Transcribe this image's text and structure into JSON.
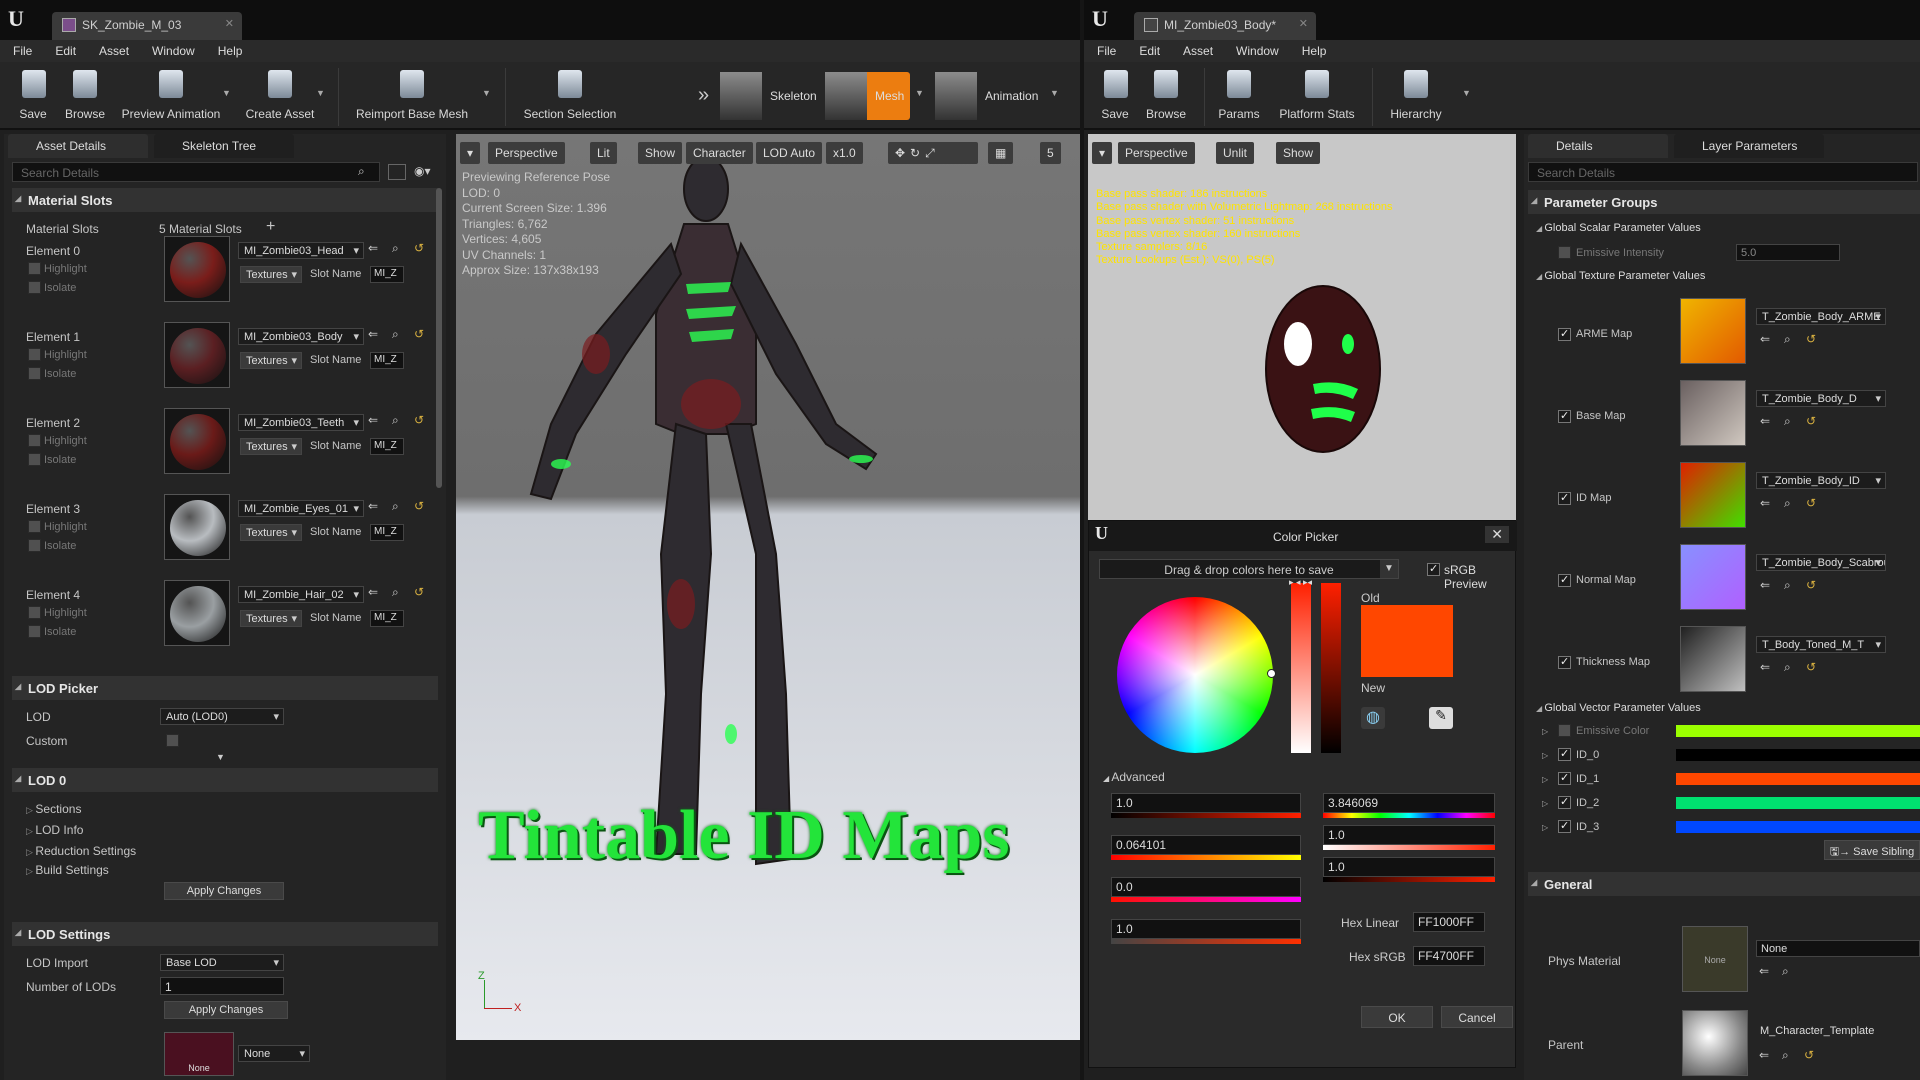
{
  "left_window": {
    "tab_title": "SK_Zombie_M_03",
    "menu": [
      "File",
      "Edit",
      "Asset",
      "Window",
      "Help"
    ],
    "toolbar": [
      {
        "label": "Save",
        "icon": "save-icon"
      },
      {
        "label": "Browse",
        "icon": "browse-icon"
      },
      {
        "label": "Preview Animation",
        "icon": "preview-animation-icon"
      },
      {
        "label": "Create Asset",
        "icon": "create-asset-icon"
      },
      {
        "label": "Reimport Base Mesh",
        "icon": "reimport-icon"
      },
      {
        "label": "Section Selection",
        "icon": "section-selection-icon"
      }
    ],
    "modes": [
      {
        "label": "Skeleton"
      },
      {
        "label": "Mesh",
        "active": true
      },
      {
        "label": "Animation"
      }
    ],
    "panel_tabs": [
      "Asset Details",
      "Skeleton Tree"
    ],
    "search_placeholder": "Search Details",
    "material_slots": {
      "category": "Material Slots",
      "label": "Material Slots",
      "count_text": "5 Material Slots",
      "add_icon": "+",
      "highlight_label": "Highlight",
      "isolate_label": "Isolate",
      "textures_label": "Textures",
      "slot_name_label": "Slot Name",
      "elements": [
        {
          "label": "Element 0",
          "material": "MI_Zombie03_Head",
          "slot": "MI_Z",
          "thumb": "#7a1d1a"
        },
        {
          "label": "Element 1",
          "material": "MI_Zombie03_Body",
          "slot": "MI_Z",
          "thumb": "#5b1f22"
        },
        {
          "label": "Element 2",
          "material": "MI_Zombie03_Teeth",
          "slot": "MI_Z",
          "thumb": "#6a1a18"
        },
        {
          "label": "Element 3",
          "material": "MI_Zombie_Eyes_01",
          "slot": "MI_Z",
          "thumb": "#b8bcc0"
        },
        {
          "label": "Element 4",
          "material": "MI_Zombie_Hair_02",
          "slot": "MI_Z",
          "thumb": "#9a9fa2"
        }
      ]
    },
    "lod_picker": {
      "category": "LOD Picker",
      "lod_label": "LOD",
      "lod_value": "Auto (LOD0)",
      "custom_label": "Custom"
    },
    "lod0": {
      "category": "LOD 0",
      "items": [
        "Sections",
        "LOD Info",
        "Reduction Settings",
        "Build Settings"
      ],
      "apply": "Apply Changes"
    },
    "lod_settings": {
      "category": "LOD Settings",
      "import_label": "LOD Import",
      "import_value": "Base LOD",
      "num_label": "Number of LODs",
      "num_value": "1",
      "apply": "Apply Changes",
      "thumb_label": "None",
      "thumb_dropdown": "None"
    },
    "viewport": {
      "buttons": [
        "Perspective",
        "Lit",
        "Show",
        "Character",
        "LOD Auto",
        "x1.0"
      ],
      "grid_value": "5",
      "info": [
        "Previewing Reference Pose",
        "LOD: 0",
        "Current Screen Size: 1.396",
        "Triangles: 6,762",
        "Vertices: 4,605",
        "UV Channels: 1",
        "Approx Size: 137x38x193"
      ],
      "overlay_text": "Tintable ID Maps",
      "axis_z": "Z",
      "axis_x": "X"
    }
  },
  "right_window": {
    "tab_title": "MI_Zombie03_Body*",
    "menu": [
      "File",
      "Edit",
      "Asset",
      "Window",
      "Help"
    ],
    "toolbar": [
      {
        "label": "Save",
        "icon": "save-icon"
      },
      {
        "label": "Browse",
        "icon": "browse-icon"
      },
      {
        "label": "Params",
        "icon": "params-icon"
      },
      {
        "label": "Platform Stats",
        "icon": "platform-stats-icon"
      },
      {
        "label": "Hierarchy",
        "icon": "hierarchy-icon"
      }
    ],
    "viewport": {
      "buttons": [
        "Perspective",
        "Unlit",
        "Show"
      ],
      "shader_stats": [
        "Base pass shader: 186 instructions",
        "Base pass shader with Volumetric Lightmap: 268 instructions",
        "Base pass vertex shader: 51 instructions",
        "Base pass vertex shader: 160 instructions",
        "Texture samplers: 8/16",
        "Texture Lookups (Est.): VS(0), PS(5)"
      ]
    },
    "details": {
      "tabs": [
        "Details",
        "Layer Parameters"
      ],
      "search_placeholder": "Search Details",
      "param_groups": "Parameter Groups",
      "scalar_group": "Global Scalar Parameter Values",
      "emissive_intensity": {
        "label": "Emissive Intensity",
        "value": "5.0"
      },
      "texture_group": "Global Texture Parameter Values",
      "textures": [
        {
          "label": "ARME Map",
          "asset": "T_Zombie_Body_ARME"
        },
        {
          "label": "Base Map",
          "asset": "T_Zombie_Body_D"
        },
        {
          "label": "ID Map",
          "asset": "T_Zombie_Body_ID"
        },
        {
          "label": "Normal Map",
          "asset": "T_Zombie_Body_Scabrous"
        },
        {
          "label": "Thickness Map",
          "asset": "T_Body_Toned_M_T"
        }
      ],
      "vector_group": "Global Vector Parameter Values",
      "vectors": [
        {
          "label": "Emissive Color",
          "color": "#9bff00",
          "enabled": false
        },
        {
          "label": "ID_0",
          "color": "#000000",
          "enabled": true
        },
        {
          "label": "ID_1",
          "color": "#ff4700",
          "enabled": true
        },
        {
          "label": "ID_2",
          "color": "#00e070",
          "enabled": true
        },
        {
          "label": "ID_3",
          "color": "#0048ff",
          "enabled": true
        }
      ],
      "save_sibling": "Save Sibling",
      "general": "General",
      "phys_material": {
        "label": "Phys Material",
        "value": "None",
        "thumb": "None"
      },
      "parent": {
        "label": "Parent",
        "value": "M_Character_Template"
      }
    },
    "color_picker": {
      "title": "Color Picker",
      "drop_text": "Drag & drop colors here to save",
      "srgb_preview": "sRGB Preview",
      "old_label": "Old",
      "new_label": "New",
      "advanced": "Advanced",
      "R": "1.0",
      "G": "0.064101",
      "B": "0.0",
      "A": "1.0",
      "H": "3.846069",
      "S": "1.0",
      "V": "1.0",
      "hex_linear_label": "Hex Linear",
      "hex_linear": "FF1000FF",
      "hex_srgb_label": "Hex sRGB",
      "hex_srgb": "FF4700FF",
      "ok": "OK",
      "cancel": "Cancel",
      "color": "#ff4700"
    }
  }
}
